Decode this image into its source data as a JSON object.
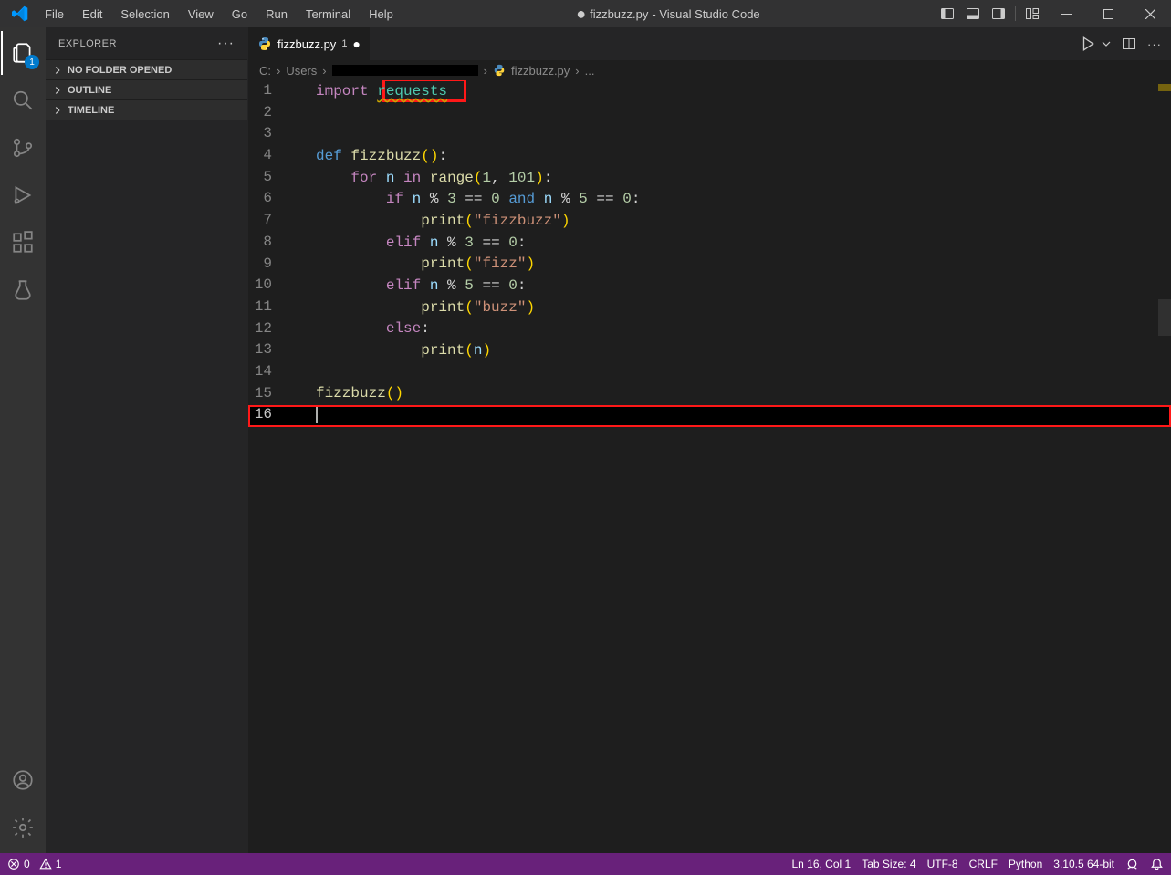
{
  "menu": [
    "File",
    "Edit",
    "Selection",
    "View",
    "Go",
    "Run",
    "Terminal",
    "Help"
  ],
  "title": {
    "prefix_dot": "●",
    "filename": "fizzbuzz.py",
    "suffix": " - Visual Studio Code"
  },
  "activity": {
    "explorer_badge": "1"
  },
  "sidebar": {
    "title": "EXPLORER",
    "sections": [
      "NO FOLDER OPENED",
      "OUTLINE",
      "TIMELINE"
    ]
  },
  "tab": {
    "label": "fizzbuzz.py",
    "modcount": "1"
  },
  "breadcrumbs": {
    "root": "C:",
    "folder1": "Users",
    "file": "fizzbuzz.py",
    "tail": "..."
  },
  "gutter": [
    "1",
    "2",
    "3",
    "4",
    "5",
    "6",
    "7",
    "8",
    "9",
    "10",
    "11",
    "12",
    "13",
    "14",
    "15",
    "16"
  ],
  "code": {
    "l1": {
      "import": "import ",
      "requests": "requests"
    },
    "l4": {
      "def": "def",
      "name": "fizzbuzz",
      "po": "(",
      "pc": ")",
      "colon": ":"
    },
    "l5": {
      "for": "for",
      "n": "n",
      "in": "in",
      "range": "range",
      "po": "(",
      "a": "1",
      "comma": ", ",
      "b": "101",
      "pc": ")",
      "colon": ":"
    },
    "l6": {
      "if": "if",
      "n1": "n",
      "mod": "%",
      "three": "3",
      "eq": "==",
      "zero": "0",
      "and": "and",
      "n2": "n",
      "five": "5",
      "zero2": "0",
      "colon": ":"
    },
    "l7": {
      "print": "print",
      "po": "(",
      "str": "\"fizzbuzz\"",
      "pc": ")"
    },
    "l8": {
      "elif": "elif",
      "n": "n",
      "mod": "%",
      "three": "3",
      "eq": "==",
      "zero": "0",
      "colon": ":"
    },
    "l9": {
      "print": "print",
      "po": "(",
      "str": "\"fizz\"",
      "pc": ")"
    },
    "l10": {
      "elif": "elif",
      "n": "n",
      "mod": "%",
      "five": "5",
      "eq": "==",
      "zero": "0",
      "colon": ":"
    },
    "l11": {
      "print": "print",
      "po": "(",
      "str": "\"buzz\"",
      "pc": ")"
    },
    "l12": {
      "else": "else",
      "colon": ":"
    },
    "l13": {
      "print": "print",
      "po": "(",
      "n": "n",
      "pc": ")"
    },
    "l15": {
      "name": "fizzbuzz",
      "po": "(",
      "pc": ")"
    }
  },
  "statusbar": {
    "errors": "0",
    "warnings": "1",
    "ln_col": "Ln 16, Col 1",
    "tab_size": "Tab Size: 4",
    "encoding": "UTF-8",
    "eol": "CRLF",
    "lang": "Python",
    "interp": "3.10.5 64-bit"
  }
}
